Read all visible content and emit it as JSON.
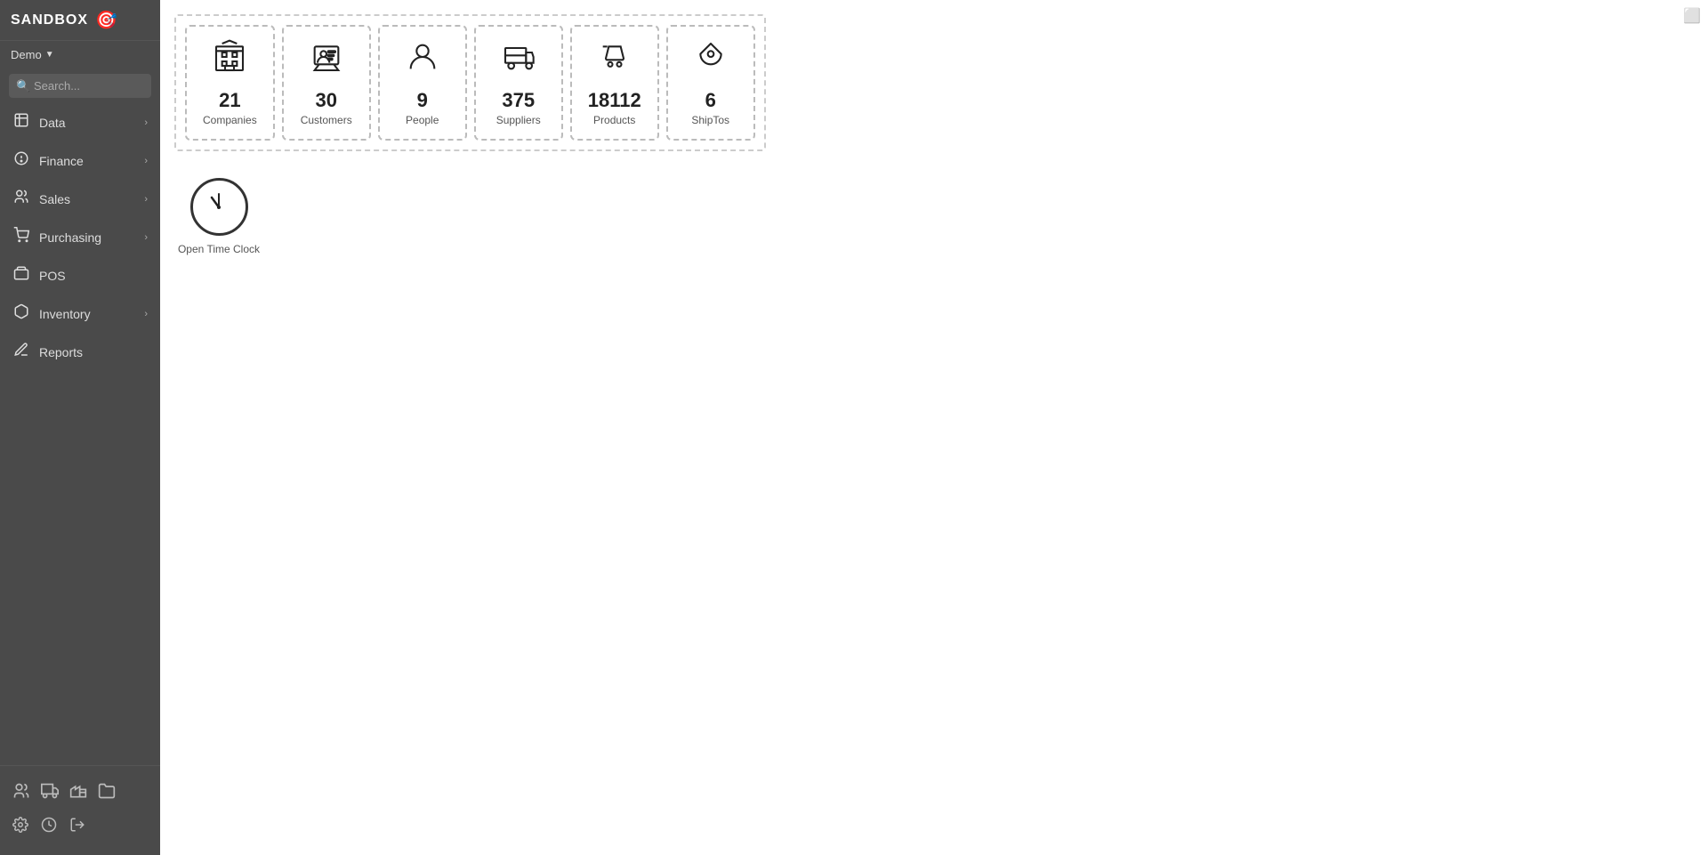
{
  "sidebar": {
    "logo_text": "SANDBOX",
    "demo_label": "Demo",
    "search_placeholder": "Search...",
    "nav_items": [
      {
        "id": "data",
        "label": "Data",
        "icon": "📋",
        "has_arrow": true
      },
      {
        "id": "finance",
        "label": "Finance",
        "icon": "💰",
        "has_arrow": true
      },
      {
        "id": "sales",
        "label": "Sales",
        "icon": "👥",
        "has_arrow": true
      },
      {
        "id": "purchasing",
        "label": "Purchasing",
        "icon": "🛒",
        "has_arrow": true
      },
      {
        "id": "pos",
        "label": "POS",
        "icon": "🏷",
        "has_arrow": false
      },
      {
        "id": "inventory",
        "label": "Inventory",
        "icon": "📦",
        "has_arrow": true
      },
      {
        "id": "reports",
        "label": "Reports",
        "icon": "📊",
        "has_arrow": false
      }
    ],
    "bottom_icons": [
      "👤",
      "🚚",
      "🏭",
      "📁"
    ],
    "footer_icons": [
      "⚙",
      "🕐",
      "↗"
    ]
  },
  "stats": [
    {
      "id": "companies",
      "number": "21",
      "label": "Companies"
    },
    {
      "id": "customers",
      "number": "30",
      "label": "Customers"
    },
    {
      "id": "people",
      "number": "9",
      "label": "People"
    },
    {
      "id": "suppliers",
      "number": "375",
      "label": "Suppliers"
    },
    {
      "id": "products",
      "number": "18112",
      "label": "Products"
    },
    {
      "id": "shiptos",
      "number": "6",
      "label": "ShipTos"
    }
  ],
  "clock_widget": {
    "label": "Open Time Clock"
  },
  "corner": {
    "icon": "⬜"
  }
}
